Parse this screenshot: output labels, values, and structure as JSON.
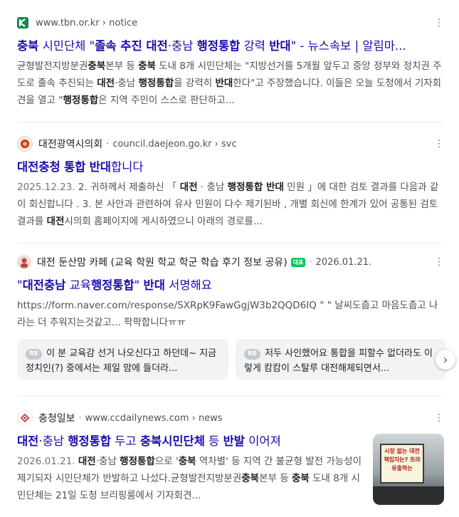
{
  "results": [
    {
      "site_name": "",
      "url": "www.tbn.or.kr › notice",
      "title": "충북 시민단체 \"졸속 추진 대전·충남 행정통합 강력 반대\" - 뉴스속보 | 알림마...",
      "snippet": "균형발전지방분권충북본부 등 충북 도내 8개 시민단체는 \"지방선거를 5개월 앞두고 중앙 정부와 정치권 주도로 졸속 추진되는 대전·충남 행정통합을 강력히 반대한다\"고 주장했습니다. 이들은 오늘 도청에서 기자회견을 열고 \"행정통합은 지역 주민이 스스로 판단하고..."
    },
    {
      "site_name": "대전광역시의회",
      "url": "council.daejeon.go.kr › svc",
      "title": "대전충청 통합 반대합니다",
      "date": "2025.12.23.",
      "snippet": "2. 귀하께서 제출하신 「 대전 · 충남 행정통합 반대 민원 」에 대한 검토 결과를 다음과 같이 회신합니다 . 3. 본 사안과 관련하여 유사 민원이 다수 제기된바 , 개별 회신에 한계가 있어 공통된 검토 결과를 대전시의회 홈페이지에 게시하였으니 아래의 경로를..."
    },
    {
      "site_name": "대전 둔산맘 카페 (교육 학원 학교 학군 학습 후기 정보 공유)",
      "badge": "대표",
      "date": "2026.01.21.",
      "title": "\"대전충남 교육행정통합\" 반대 서명해요",
      "snippet": "https://form.naver.com/response/SXRpK9FawGgjW3b2QQD6IQ \" \" 날씨도춥고 마음도춥고 나라는 더 추워지는것같고... 팍팍합니다ㅠㅠ",
      "comments": [
        {
          "tag": "RE",
          "text": "이 분 교육감 선거 나오신다고 하던데~ 지금 정치인(?) 중에서는 제일 맘에 들더라..."
        },
        {
          "tag": "RE",
          "text": "저두 사인했어요 통합을 피할수 없더라도 이렇게 캄캄이 스탈루 대전해체되면서..."
        }
      ]
    },
    {
      "site_name": "충청일보",
      "url": "www.ccdailynews.com › news",
      "title": "대전·충남 행정통합 두고 충북시민단체 등 반발 이어져",
      "date": "2026.01.21.",
      "snippet": "대전·충남 행정통합으로 '충북 역차별' 등 지역 간 불균형 발전 가능성이 제기되자 시민단체가 반발하고 나섰다.균형발전지방분권충북본부 등 충북 도내 8개 시민단체는 21일 도청 브리핑룸에서 기자회견...",
      "thumb_text": "시장 없는 대전 책임자는? 트라 유출하는"
    }
  ],
  "icons": {
    "tbn": "K",
    "council": "emblem",
    "cafe": "avatar",
    "ccdaily": "logo"
  },
  "colors": {
    "title_link": "#1a0dab",
    "snippet": "#4d5156",
    "tbn_green": "#0d8a4a",
    "badge_green": "#03c75a"
  }
}
